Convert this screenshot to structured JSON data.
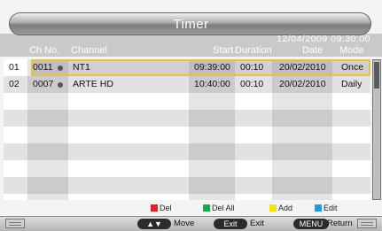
{
  "window": {
    "title": "Timer",
    "datetime": "12/04/2009  09:30:00"
  },
  "columns": {
    "ch_no": "Ch No.",
    "channel": "Channel",
    "start": "Start",
    "duration": "Duration",
    "date": "Date",
    "mode": "Mode"
  },
  "rows": [
    {
      "index": "01",
      "ch_no": "0011",
      "channel": "NT1",
      "start": "09:39:00",
      "duration": "00:10",
      "date": "20/02/2010",
      "mode": "Once",
      "selected": true
    },
    {
      "index": "02",
      "ch_no": "0007",
      "channel": "ARTE HD",
      "start": "10:40:00",
      "duration": "00:10",
      "date": "20/02/2010",
      "mode": "Daily",
      "selected": false
    }
  ],
  "legend": {
    "del": "Del",
    "del_all": "Del All",
    "add": "Add",
    "edit": "Edit"
  },
  "legend_colors": {
    "del": "#e41e26",
    "del_all": "#19a84a",
    "add": "#f7e400",
    "edit": "#1e9be8"
  },
  "footer": {
    "move_key": "▲▼",
    "move": "Move",
    "exit_key": "Exit",
    "exit": "Exit",
    "menu_key": "MENU",
    "return": "Return"
  },
  "icons": {
    "bullet": "channel-bullet-icon",
    "corner": "menu-lines-icon"
  }
}
